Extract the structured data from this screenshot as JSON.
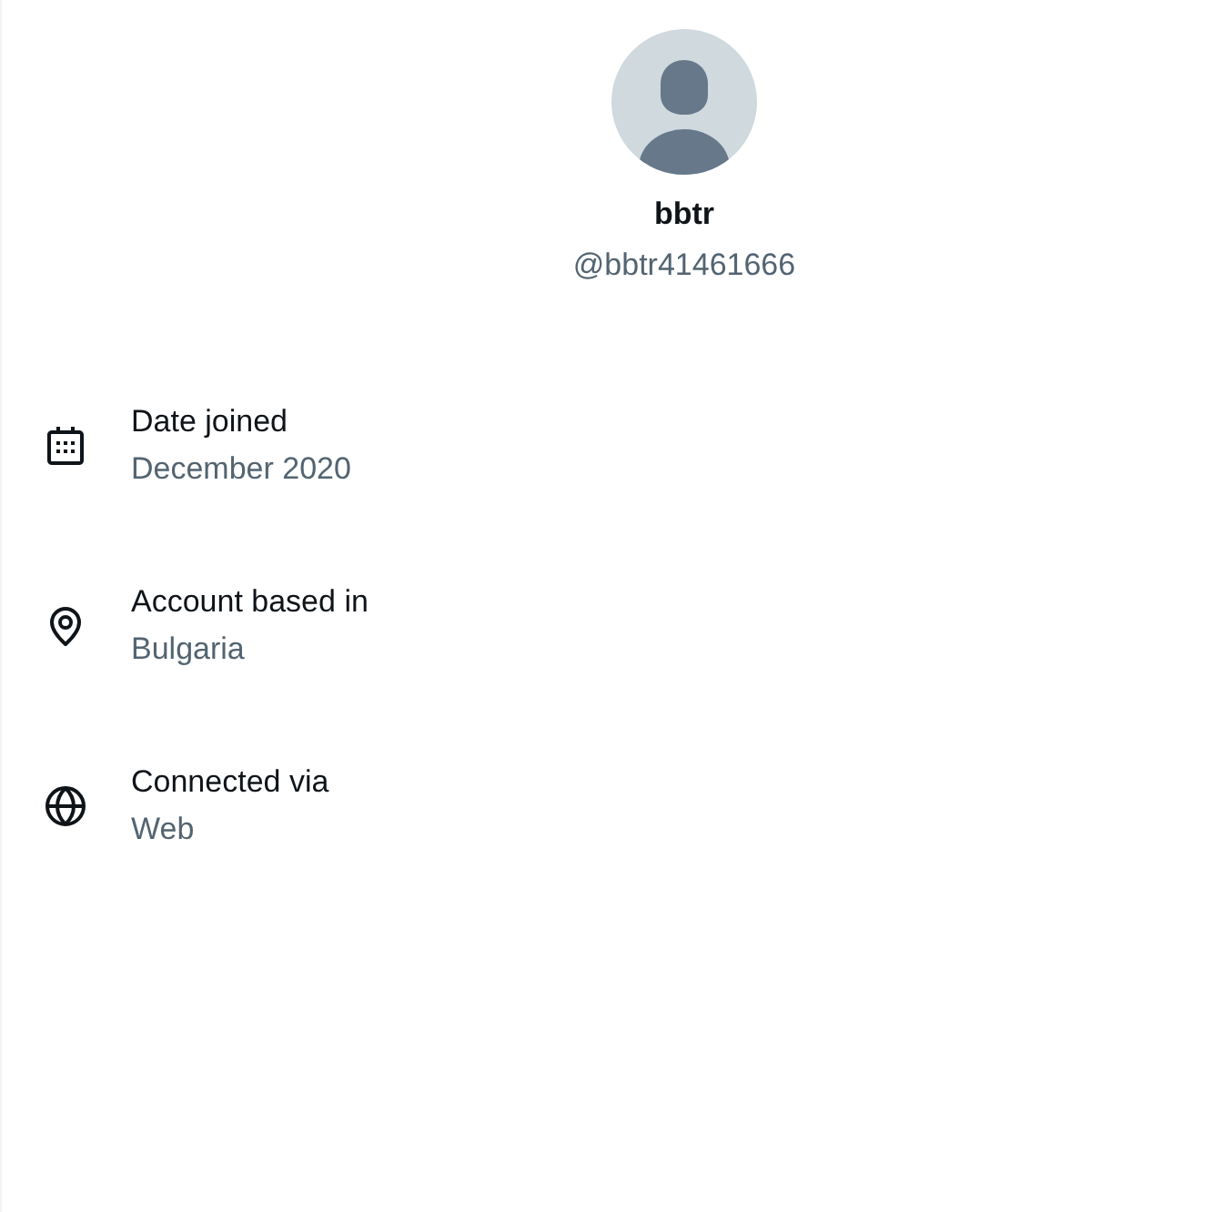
{
  "profile": {
    "name": "bbtr",
    "handle": "@bbtr41461666"
  },
  "details": [
    {
      "kind": "date",
      "label": "Date joined",
      "value": "December 2020"
    },
    {
      "kind": "location",
      "label": "Account based in",
      "value": "Bulgaria"
    },
    {
      "kind": "connection",
      "label": "Connected via",
      "value": "Web"
    }
  ]
}
